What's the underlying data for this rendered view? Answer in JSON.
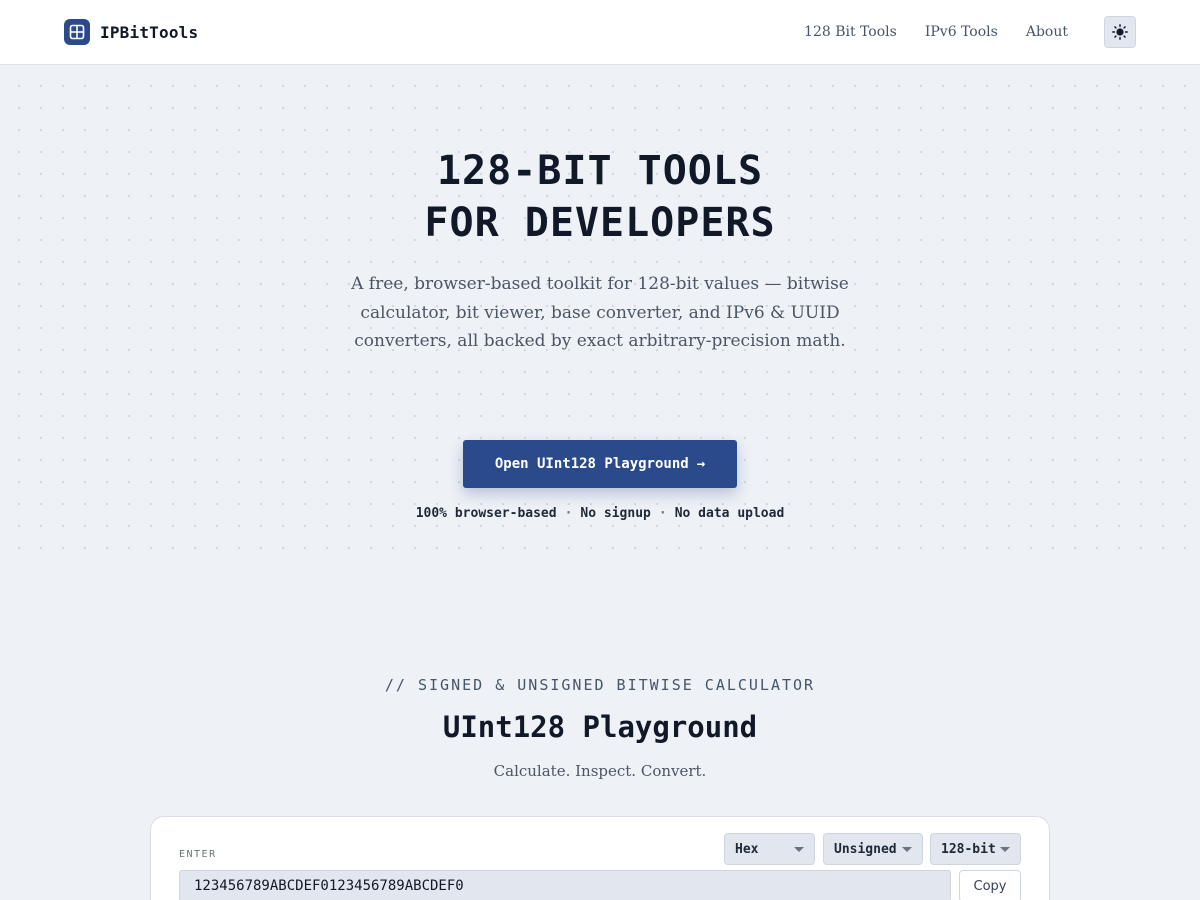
{
  "header": {
    "brand": "IPBitTools",
    "nav": [
      "128 Bit Tools",
      "IPv6 Tools",
      "About"
    ]
  },
  "hero": {
    "title_line1": "128-BIT TOOLS",
    "title_line2": "FOR DEVELOPERS",
    "subtitle": "A free, browser-based toolkit for 128-bit values — bitwise calculator, bit viewer, base converter, and IPv6 & UUID converters, all backed by exact arbitrary-precision math.",
    "cta_label": "Open UInt128 Playground",
    "cta_arrow": "→",
    "badges": [
      "100% browser-based",
      "No signup",
      "No data upload"
    ],
    "badge_separator": "·"
  },
  "playground": {
    "eyebrow": "// SIGNED & UNSIGNED BITWISE CALCULATOR",
    "title": "UInt128 Playground",
    "subtitle": "Calculate. Inspect. Convert.",
    "enter_label": "ENTER",
    "base_select": "Hex",
    "sign_select": "Unsigned",
    "width_select": "128-bit",
    "input_value": "123456789ABCDEF0123456789ABCDEF0",
    "copy_label": "Copy"
  },
  "colors": {
    "brand": "#2b4a8b",
    "background": "#eef1f6"
  },
  "icons": {
    "logo": "grid-icon",
    "theme": "sun-icon"
  }
}
